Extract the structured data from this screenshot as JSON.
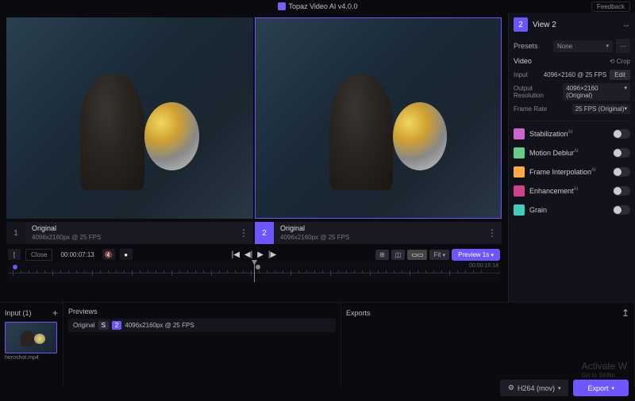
{
  "title": "Topaz Video AI  v4.0.0",
  "feedback_label": "Feedback",
  "viewers": [
    {
      "num": "1",
      "name": "Original",
      "res": "4096x2160px @ 25 FPS"
    },
    {
      "num": "2",
      "name": "Original",
      "res": "4096x2160px @ 25 FPS"
    }
  ],
  "timeline": {
    "close_label": "Close",
    "timecode": "00:00:07:13",
    "duration": "00:00:15:14",
    "compare_modes": [
      "⊞",
      "◫",
      "▭▭"
    ],
    "fit_label": "Fit",
    "preview_label": "Preview 1s"
  },
  "right": {
    "badge": "2",
    "view_title": "View 2",
    "presets_label": "Presets",
    "presets_value": "None",
    "video_label": "Video",
    "crop_label": "Crop",
    "input_label": "Input",
    "input_value": "4096×2160 @ 25 FPS",
    "edit_label": "Edit",
    "out_res_label": "Output Resolution",
    "out_res_value": "4096×2160 (Original)",
    "fps_label": "Frame Rate",
    "fps_value": "25 FPS (Original)",
    "filters": [
      {
        "name": "Stabilization",
        "ai": true,
        "color": "#cc66cc"
      },
      {
        "name": "Motion Deblur",
        "ai": true,
        "color": "#66cc88"
      },
      {
        "name": "Frame Interpolation",
        "ai": true,
        "color": "#ffaa44"
      },
      {
        "name": "Enhancement",
        "ai": true,
        "color": "#cc4488"
      },
      {
        "name": "Grain",
        "ai": false,
        "color": "#44ccbb"
      }
    ]
  },
  "bottom": {
    "input_label": "Input (1)",
    "thumb_name": "heroshot.mp4",
    "previews_label": "Previews",
    "preview_row": {
      "name": "Original",
      "tag1": "S",
      "tag2": "2",
      "res": "4096x2160px @ 25 FPS"
    },
    "exports_label": "Exports"
  },
  "watermark": {
    "line1": "Activate W",
    "line2": "Go to Settin"
  },
  "footer": {
    "codec": "H264 (mov)",
    "export": "Export"
  }
}
